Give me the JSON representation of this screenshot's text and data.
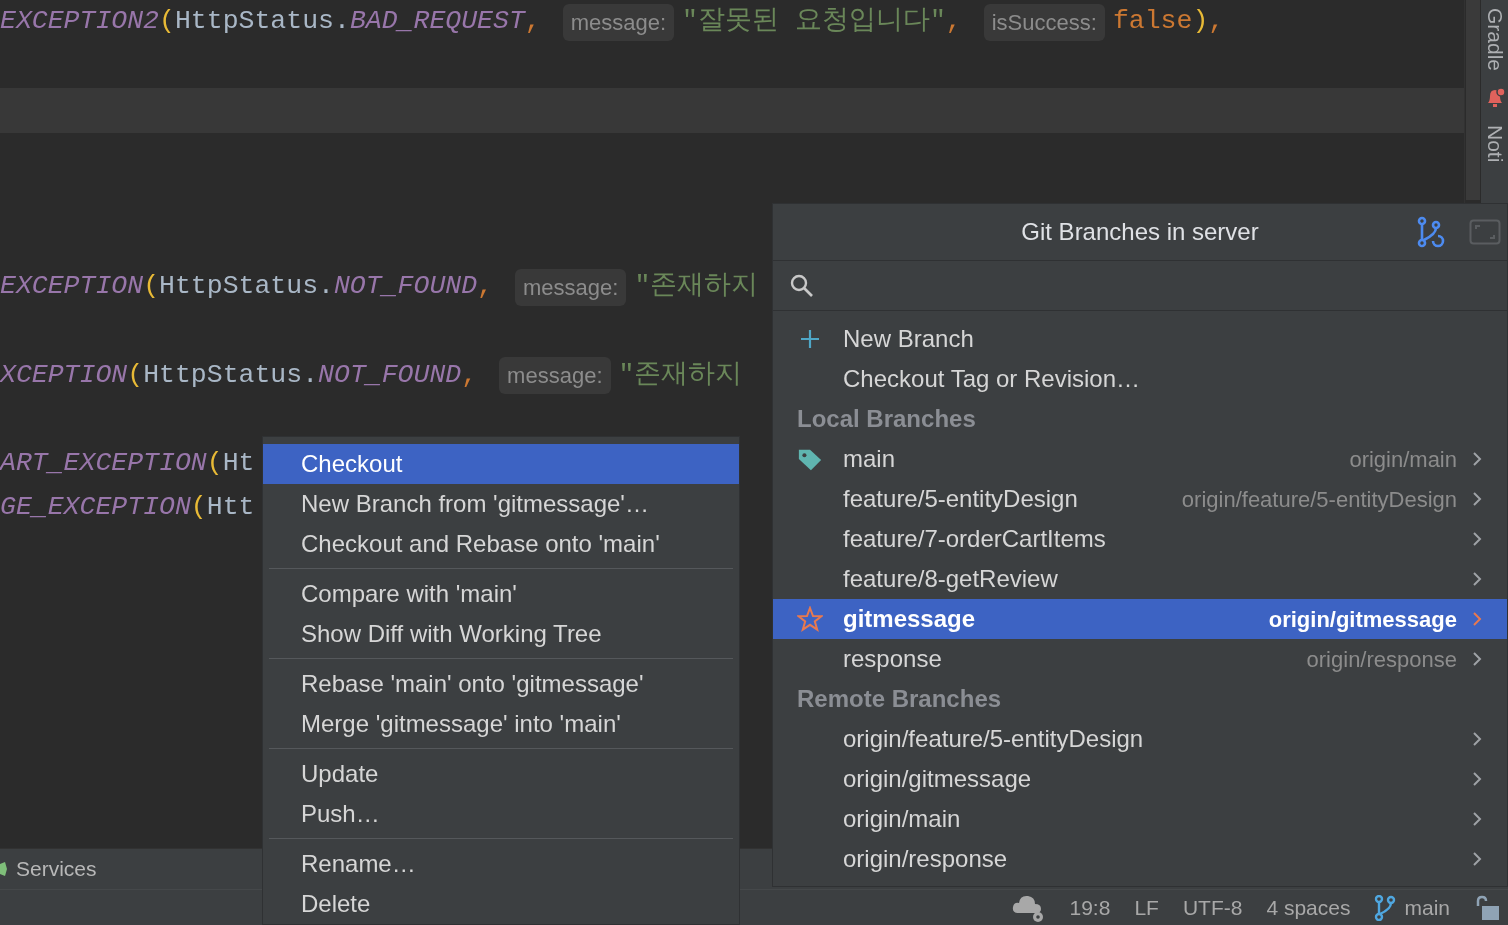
{
  "editor": {
    "lines": [
      {
        "kind": "code",
        "tokens": [
          {
            "kind": "constant",
            "text": "EXCEPTION2"
          },
          {
            "kind": "paren",
            "text": "("
          },
          {
            "kind": "text",
            "text": "HttpStatus."
          },
          {
            "kind": "constant",
            "text": "BAD_REQUEST"
          },
          {
            "kind": "comma",
            "text": ","
          },
          {
            "kind": "hint",
            "text": "message:"
          },
          {
            "kind": "string",
            "text": "\"잘못된 요청입니다\""
          },
          {
            "kind": "comma",
            "text": ","
          },
          {
            "kind": "hint",
            "text": "isSuccess:"
          },
          {
            "kind": "keyword",
            "text": "false"
          },
          {
            "kind": "paren",
            "text": ")"
          },
          {
            "kind": "comma",
            "text": ","
          }
        ]
      },
      {
        "kind": "blank"
      },
      {
        "kind": "caret"
      },
      {
        "kind": "blank"
      },
      {
        "kind": "blank"
      },
      {
        "kind": "blank"
      },
      {
        "kind": "code",
        "tokens": [
          {
            "kind": "constant",
            "text": "EXCEPTION"
          },
          {
            "kind": "paren",
            "text": "("
          },
          {
            "kind": "text",
            "text": "HttpStatus."
          },
          {
            "kind": "constant",
            "text": "NOT_FOUND"
          },
          {
            "kind": "comma",
            "text": ","
          },
          {
            "kind": "hint",
            "text": "message:"
          },
          {
            "kind": "string",
            "text": "\"존재하지"
          }
        ]
      },
      {
        "kind": "blank"
      },
      {
        "kind": "code",
        "tokens": [
          {
            "kind": "constant",
            "text": "XCEPTION"
          },
          {
            "kind": "paren",
            "text": "("
          },
          {
            "kind": "text",
            "text": "HttpStatus."
          },
          {
            "kind": "constant",
            "text": "NOT_FOUND"
          },
          {
            "kind": "comma",
            "text": ","
          },
          {
            "kind": "hint",
            "text": "message:"
          },
          {
            "kind": "string",
            "text": "\"존재하지"
          }
        ]
      },
      {
        "kind": "blank"
      },
      {
        "kind": "code",
        "tokens": [
          {
            "kind": "constant",
            "text": "ART_EXCEPTION"
          },
          {
            "kind": "paren",
            "text": "("
          },
          {
            "kind": "text",
            "text": "Ht"
          }
        ]
      },
      {
        "kind": "code",
        "tokens": [
          {
            "kind": "constant",
            "text": "GE_EXCEPTION"
          },
          {
            "kind": "paren",
            "text": "("
          },
          {
            "kind": "text",
            "text": "Htt"
          }
        ]
      }
    ]
  },
  "right_toolbar": [
    {
      "label": "Gradle",
      "kind": "plain"
    },
    {
      "label": "Noti",
      "kind": "alert"
    }
  ],
  "services": {
    "label": "Services"
  },
  "context_menu": {
    "groups": [
      {
        "items": [
          {
            "label": "Checkout",
            "selected": true
          },
          {
            "label": "New Branch from 'gitmessage'…",
            "selected": false
          },
          {
            "label": "Checkout and Rebase onto 'main'",
            "selected": false
          }
        ]
      },
      {
        "items": [
          {
            "label": "Compare with 'main'",
            "selected": false
          },
          {
            "label": "Show Diff with Working Tree",
            "selected": false
          }
        ]
      },
      {
        "items": [
          {
            "label": "Rebase 'main' onto 'gitmessage'",
            "selected": false
          },
          {
            "label": "Merge 'gitmessage' into 'main'",
            "selected": false
          }
        ]
      },
      {
        "items": [
          {
            "label": "Update",
            "selected": false
          },
          {
            "label": "Push…",
            "selected": false
          }
        ]
      },
      {
        "items": [
          {
            "label": "Rename…",
            "selected": false
          },
          {
            "label": "Delete",
            "selected": false
          }
        ]
      }
    ]
  },
  "branches_popup": {
    "title": "Git Branches in server",
    "actions": [
      {
        "label": "New Branch",
        "kind": "create"
      },
      {
        "label": "Checkout Tag or Revision…",
        "kind": "plain"
      }
    ],
    "sections": [
      {
        "title": "Local Branches",
        "branches": [
          {
            "name": "main",
            "remote": "origin/main",
            "kind": "current",
            "selected": false
          },
          {
            "name": "feature/5-entityDesign",
            "remote": "origin/feature/5-entityDesign",
            "kind": "plain",
            "selected": false
          },
          {
            "name": "feature/7-orderCartItems",
            "kind": "plain",
            "selected": false
          },
          {
            "name": "feature/8-getReview",
            "kind": "plain",
            "selected": false
          },
          {
            "name": "gitmessage",
            "remote": "origin/gitmessage",
            "kind": "favorite",
            "selected": true
          },
          {
            "name": "response",
            "remote": "origin/response",
            "kind": "plain",
            "selected": false
          }
        ]
      },
      {
        "title": "Remote Branches",
        "branches": [
          {
            "name": "origin/feature/5-entityDesign",
            "kind": "plain",
            "selected": false
          },
          {
            "name": "origin/gitmessage",
            "kind": "plain",
            "selected": false
          },
          {
            "name": "origin/main",
            "kind": "plain",
            "selected": false
          },
          {
            "name": "origin/response",
            "kind": "plain",
            "selected": false
          }
        ]
      }
    ]
  },
  "status_bar": {
    "items": [
      "19:8",
      "LF",
      "UTF-8",
      "4 spaces"
    ],
    "branch": "main"
  }
}
